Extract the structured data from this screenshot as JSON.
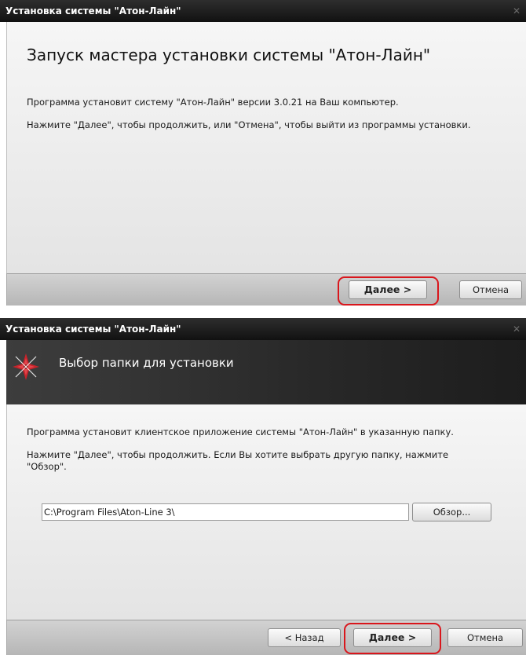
{
  "window1": {
    "title": "Установка системы \"Атон-Лайн\"",
    "close_glyph": "✕",
    "heading": "Запуск мастера установки системы \"Атон-Лайн\"",
    "paragraph1": "Программа установит систему \"Атон-Лайн\" версии 3.0.21 на Ваш компьютер.",
    "paragraph2": "Нажмите \"Далее\", чтобы продолжить, или \"Отмена\", чтобы выйти из программы установки.",
    "next_button": "Далее >",
    "cancel_button": "Отмена"
  },
  "window2": {
    "title": "Установка системы \"Атон-Лайн\"",
    "close_glyph": "✕",
    "header_title": "Выбор папки для установки",
    "logo_icon": "aton-line-logo-icon",
    "paragraph1": "Программа установит клиентское приложение системы \"Атон-Лайн\" в указанную папку.",
    "paragraph2": "Нажмите \"Далее\", чтобы продолжить. Если Вы хотите выбрать другую папку, нажмите \"Обзор\".",
    "path_value": "C:\\Program Files\\Aton-Line 3\\",
    "browse_button": "Обзор...",
    "back_button": "< Назад",
    "next_button": "Далее >",
    "cancel_button": "Отмена"
  },
  "colors": {
    "highlight": "#d9161c",
    "title_bar": "#1e1e1e",
    "logo_red": "#c8242b"
  }
}
